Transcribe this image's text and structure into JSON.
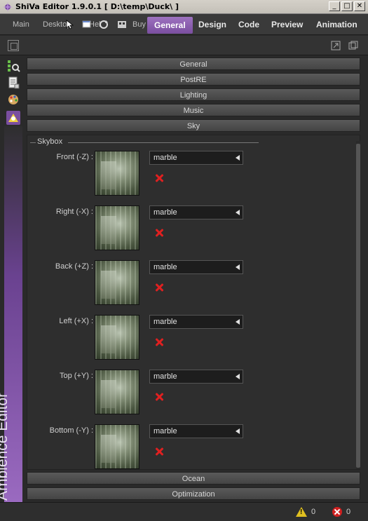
{
  "window": {
    "title": "ShiVa Editor 1.9.0.1 [ D:\\temp\\Duck\\ ]",
    "minimize": "_",
    "maximize": "□",
    "close": "✕"
  },
  "menubar": {
    "main": "Main",
    "desktop": "Desktop",
    "help": "Hel",
    "buy": "Buy",
    "tabs": [
      "General",
      "Design",
      "Code",
      "Preview",
      "Animation"
    ],
    "active_tab": "General"
  },
  "side_panel": {
    "title": "Ambience Editor"
  },
  "sections": {
    "general": "General",
    "postre": "PostRE",
    "lighting": "Lighting",
    "music": "Music",
    "sky": "Sky",
    "ocean": "Ocean",
    "optimization": "Optimization"
  },
  "skybox": {
    "group_title": "Skybox",
    "faces": [
      {
        "label": "Front (-Z) :",
        "texture": "marble"
      },
      {
        "label": "Right (-X) :",
        "texture": "marble"
      },
      {
        "label": "Back (+Z) :",
        "texture": "marble"
      },
      {
        "label": "Left (+X) :",
        "texture": "marble"
      },
      {
        "label": "Top (+Y) :",
        "texture": "marble"
      },
      {
        "label": "Bottom (-Y) :",
        "texture": "marble"
      }
    ]
  },
  "status": {
    "warnings": "0",
    "errors": "0"
  },
  "colors": {
    "accent": "#7a4ea0",
    "background": "#2a2a2a",
    "error": "#d02020",
    "warning": "#e0c020"
  }
}
